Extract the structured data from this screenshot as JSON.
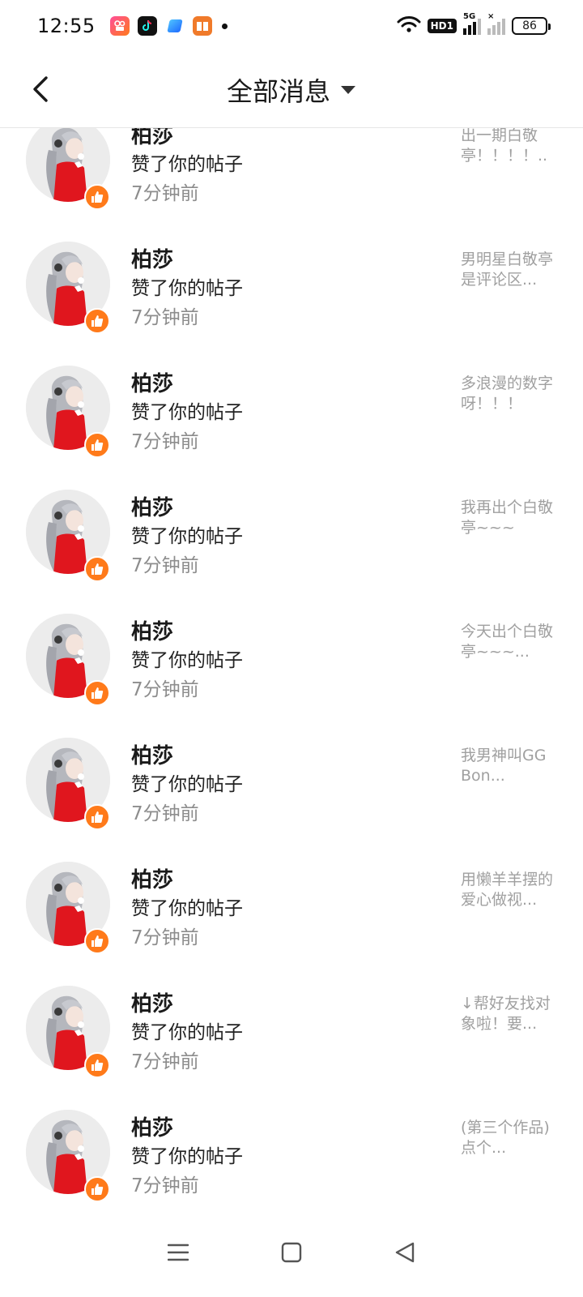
{
  "status_bar": {
    "time": "12:55",
    "apps": [
      "kuaishou-icon",
      "douyin-icon",
      "blue-app-icon",
      "book-app-icon"
    ],
    "network_label": "5G",
    "hd_label": "HD1",
    "battery": "86"
  },
  "header": {
    "title": "全部消息",
    "back_icon": "chevron-left-icon",
    "dropdown_icon": "caret-down-icon"
  },
  "messages": [
    {
      "name": "柏莎",
      "action": "赞了你的帖子",
      "time": "7分钟前",
      "preview": "出一期白敬亭！！！！.."
    },
    {
      "name": "柏莎",
      "action": "赞了你的帖子",
      "time": "7分钟前",
      "preview": "男明星白敬亭是评论区..."
    },
    {
      "name": "柏莎",
      "action": "赞了你的帖子",
      "time": "7分钟前",
      "preview": "多浪漫的数字呀！！！"
    },
    {
      "name": "柏莎",
      "action": "赞了你的帖子",
      "time": "7分钟前",
      "preview": "我再出个白敬亭~~~"
    },
    {
      "name": "柏莎",
      "action": "赞了你的帖子",
      "time": "7分钟前",
      "preview": "今天出个白敬亭~~~..."
    },
    {
      "name": "柏莎",
      "action": "赞了你的帖子",
      "time": "7分钟前",
      "preview": "我男神叫GGBon..."
    },
    {
      "name": "柏莎",
      "action": "赞了你的帖子",
      "time": "7分钟前",
      "preview": "用懒羊羊摆的爱心做视..."
    },
    {
      "name": "柏莎",
      "action": "赞了你的帖子",
      "time": "7分钟前",
      "preview": "↓帮好友找对象啦！要..."
    },
    {
      "name": "柏莎",
      "action": "赞了你的帖子",
      "time": "7分钟前",
      "preview": "(第三个作品)点个..."
    }
  ],
  "colors": {
    "like_badge": "#ff7a1a",
    "avatar_dress": "#e0161e",
    "secondary_text": "#8d8d8d"
  },
  "nav_bar": {
    "menu_icon": "menu-icon",
    "home_icon": "square-home-icon",
    "back_icon": "triangle-back-icon"
  }
}
